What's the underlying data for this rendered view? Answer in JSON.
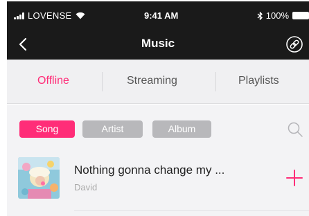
{
  "status_bar": {
    "carrier": "LOVENSE",
    "time": "9:41 AM",
    "battery": "100%"
  },
  "nav": {
    "title": "Music",
    "back_icon": "chevron-left-icon",
    "right_icon": "link-icon"
  },
  "tabs": [
    {
      "label": "Offline",
      "active": true
    },
    {
      "label": "Streaming",
      "active": false
    },
    {
      "label": "Playlists",
      "active": false
    }
  ],
  "filters": [
    {
      "label": "Song",
      "selected": true
    },
    {
      "label": "Artist",
      "selected": false
    },
    {
      "label": "Album",
      "selected": false
    }
  ],
  "tracks": [
    {
      "title": "Nothing gonna change my ...",
      "artist": "David"
    }
  ],
  "colors": {
    "accent": "#ff2d78",
    "navbar": "#1a1a1a",
    "chip_inactive": "#b8b8bb",
    "background": "#f3f3f5"
  }
}
